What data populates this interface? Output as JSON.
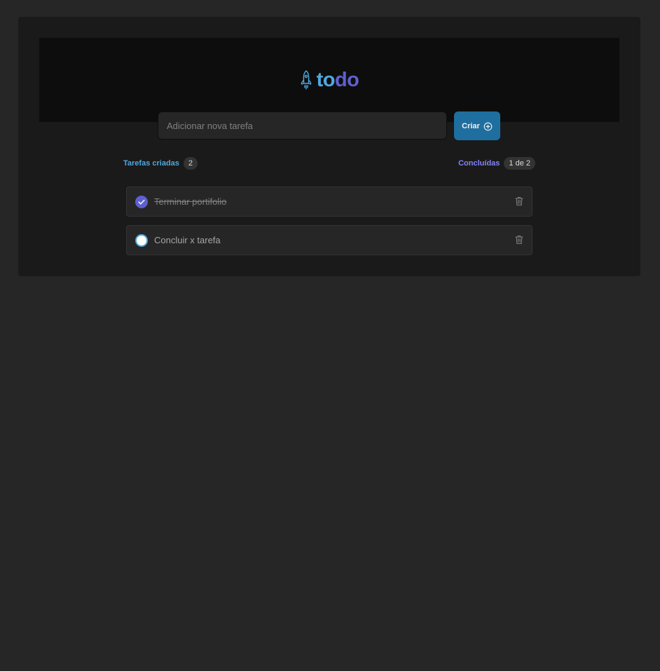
{
  "app": {
    "logo_text_part1": "to",
    "logo_text_part2": "do"
  },
  "new_task": {
    "placeholder": "Adicionar nova tarefa",
    "value": "",
    "create_label": "Criar"
  },
  "stats": {
    "created_label": "Tarefas criadas",
    "created_count": "2",
    "done_label": "Concluídas",
    "done_count": "1 de 2"
  },
  "tasks": [
    {
      "text": "Terminar portifolio",
      "completed": true
    },
    {
      "text": "Concluir x tarefa",
      "completed": false
    }
  ],
  "colors": {
    "background": "#262626",
    "card": "#1a1a1a",
    "header": "#0d0d0d",
    "blue": "#4ea8de",
    "blue_dark": "#1e6f9f",
    "purple": "#5e60ce",
    "purple_light": "#8284fa"
  },
  "icons": {
    "logo": "rocket-icon",
    "create": "plus-circle-icon",
    "checked": "check-icon",
    "delete": "trash-icon"
  }
}
